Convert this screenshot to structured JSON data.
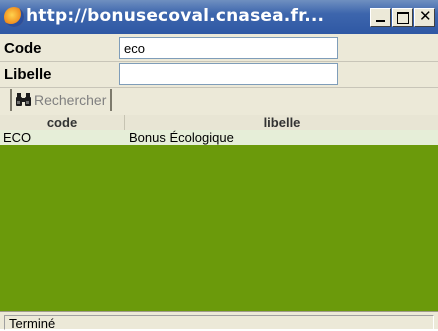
{
  "window": {
    "title": "http://bonusecoval.cnasea.fr..."
  },
  "form": {
    "code_label": "Code",
    "code_value": "eco",
    "libelle_label": "Libelle",
    "libelle_value": ""
  },
  "toolbar": {
    "search_label": "Rechercher"
  },
  "grid": {
    "columns": [
      "code",
      "libelle"
    ],
    "rows": [
      {
        "code": "ECO",
        "libelle": "Bonus Écologique"
      }
    ]
  },
  "status": {
    "text": "Terminé"
  },
  "colors": {
    "titlebar": "#2f58a4",
    "grid_background": "#6b9a0b",
    "selected_row": "#e6eed8"
  }
}
